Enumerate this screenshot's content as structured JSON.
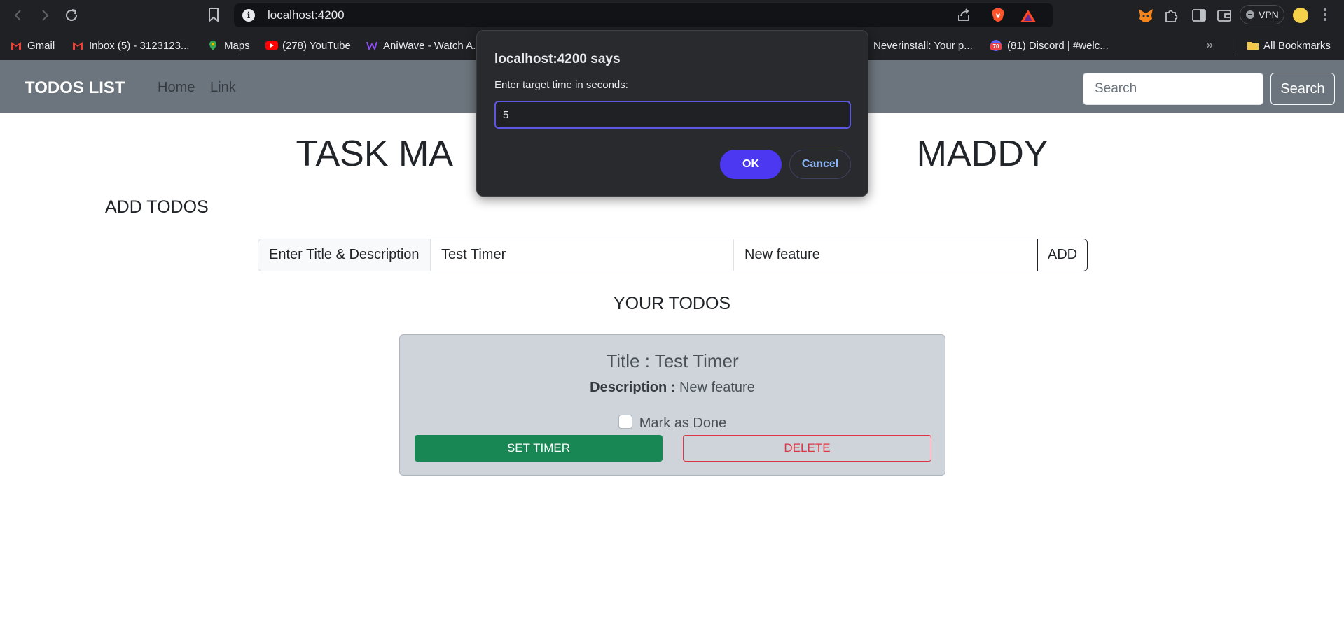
{
  "browser": {
    "url": "localhost:4200",
    "vpn_label": "VPN",
    "bookmarks": [
      {
        "label": "Gmail",
        "icon": "gmail-icon",
        "color": "#ea4335"
      },
      {
        "label": "Inbox (5) - 3123123...",
        "icon": "gmail-icon",
        "color": "#ea4335"
      },
      {
        "label": "Maps",
        "icon": "maps-icon",
        "color": "#34a853"
      },
      {
        "label": "(278) YouTube",
        "icon": "youtube-icon",
        "color": "#ff0000"
      },
      {
        "label": "AniWave - Watch A...",
        "icon": "aniwave-icon",
        "color": "#7b3fe4"
      },
      {
        "label": "Neverinstall: Your p...",
        "icon": "neverinstall-icon",
        "color": "#2c2d30"
      },
      {
        "label": "(81) Discord | #welc...",
        "icon": "discord-icon",
        "color": "#5865f2"
      }
    ],
    "all_bookmarks_label": "All Bookmarks",
    "more_glyph": "»"
  },
  "navbar": {
    "brand": "TODOS LIST",
    "links": [
      "Home",
      "Link"
    ],
    "search_placeholder": "Search",
    "search_button": "Search"
  },
  "page": {
    "title": "TASK MA                                              MADDY",
    "add_heading": "ADD TODOS",
    "input_label": "Enter Title & Description",
    "title_value": "Test Timer",
    "description_value": "New feature",
    "add_button": "ADD",
    "todos_heading": "YOUR TODOS"
  },
  "todo": {
    "title": "Title : Test Timer",
    "description_label": "Description :",
    "description": "New feature",
    "mark_done_label": "Mark as Done",
    "set_timer_button": "SET TIMER",
    "delete_button": "DELETE"
  },
  "dialog": {
    "title": "localhost:4200 says",
    "message": "Enter target time in seconds:",
    "input_value": "5",
    "ok_button": "OK",
    "cancel_button": "Cancel"
  },
  "colors": {
    "navbar_bg": "#6c757d",
    "success": "#198754",
    "danger": "#dc3545",
    "dialog_accent": "#4b38f0"
  }
}
